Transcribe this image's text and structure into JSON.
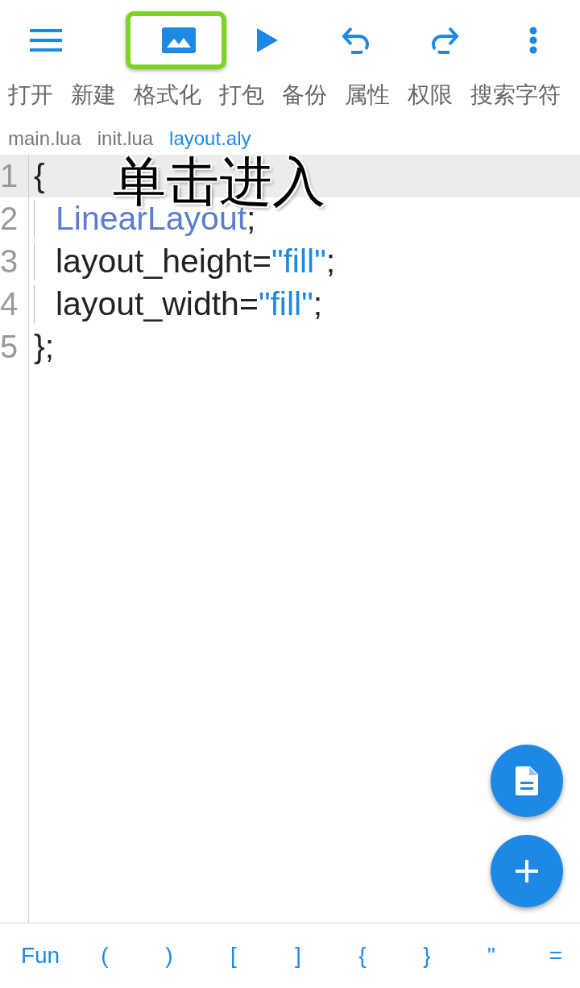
{
  "toolbar": [
    {
      "kind": "menu",
      "highlighted": false
    },
    {
      "kind": "image",
      "highlighted": true
    },
    {
      "kind": "play",
      "highlighted": false
    },
    {
      "kind": "undo",
      "highlighted": false
    },
    {
      "kind": "redo",
      "highlighted": false
    },
    {
      "kind": "more",
      "highlighted": false
    }
  ],
  "menu": [
    "打开",
    "新建",
    "格式化",
    "打包",
    "备份",
    "属性",
    "权限",
    "搜索字符"
  ],
  "files": [
    {
      "label": "main.lua",
      "selected": false
    },
    {
      "label": "init.lua",
      "selected": false
    },
    {
      "label": "layout.aly",
      "selected": true
    }
  ],
  "annotation": "单击进入",
  "code": [
    {
      "number": "1",
      "current": true,
      "indented": false,
      "tokens": [
        {
          "kind": "plain",
          "text": "{"
        }
      ]
    },
    {
      "number": "2",
      "current": false,
      "indented": true,
      "tokens": [
        {
          "kind": "type",
          "text": "LinearLayout"
        },
        {
          "kind": "plain",
          "text": ";"
        }
      ]
    },
    {
      "number": "3",
      "current": false,
      "indented": true,
      "tokens": [
        {
          "kind": "plain",
          "text": "layout_height="
        },
        {
          "kind": "string",
          "text": "\"fill\""
        },
        {
          "kind": "plain",
          "text": ";"
        }
      ]
    },
    {
      "number": "4",
      "current": false,
      "indented": true,
      "tokens": [
        {
          "kind": "plain",
          "text": "layout_width="
        },
        {
          "kind": "string",
          "text": "\"fill\""
        },
        {
          "kind": "plain",
          "text": ";"
        }
      ]
    },
    {
      "number": "5",
      "current": false,
      "indented": false,
      "tokens": [
        {
          "kind": "plain",
          "text": "};"
        }
      ]
    }
  ],
  "fabs": [
    {
      "kind": "document"
    },
    {
      "kind": "add"
    }
  ],
  "keys": [
    "Fun",
    "(",
    ")",
    "[",
    "]",
    "{",
    "}",
    "\"",
    "="
  ]
}
